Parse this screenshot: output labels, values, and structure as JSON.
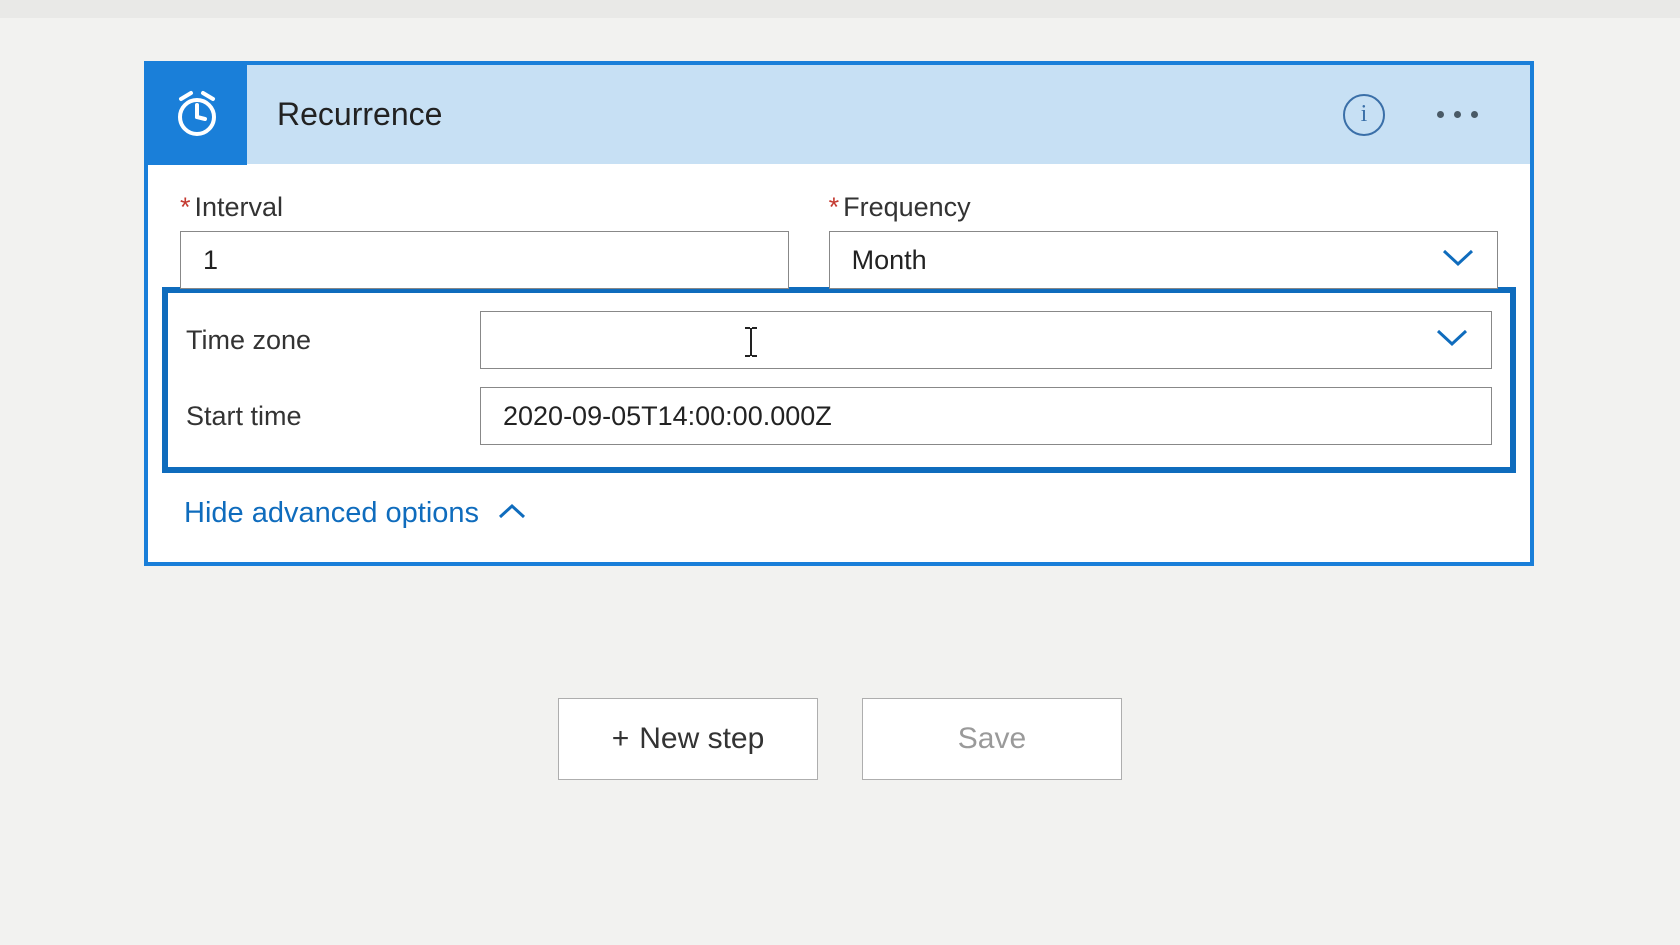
{
  "header": {
    "title": "Recurrence",
    "info_glyph": "i"
  },
  "fields": {
    "interval": {
      "label": "Interval",
      "value": "1"
    },
    "frequency": {
      "label": "Frequency",
      "value": "Month"
    },
    "timezone": {
      "label": "Time zone",
      "value": ""
    },
    "start_time": {
      "label": "Start time",
      "value": "2020-09-05T14:00:00.000Z"
    }
  },
  "advanced": {
    "toggle_label": "Hide advanced options"
  },
  "buttons": {
    "new_step": "New step",
    "save": "Save",
    "plus_glyph": "+"
  }
}
